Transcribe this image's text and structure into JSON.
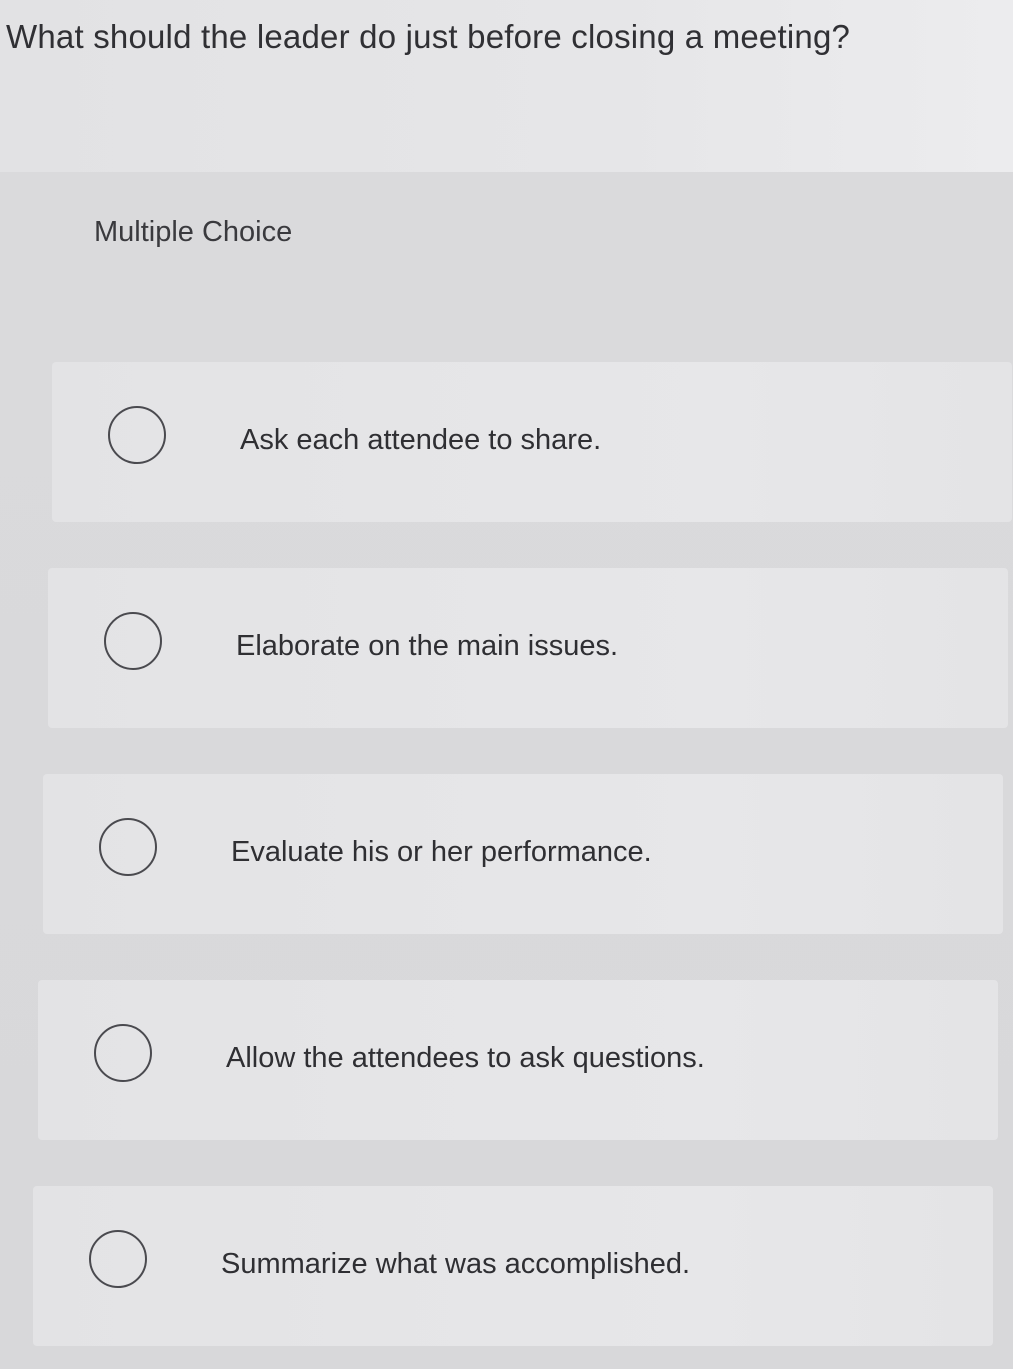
{
  "question": {
    "text": "What should the leader do just before closing a meeting?"
  },
  "question_type": "Multiple Choice",
  "options": [
    {
      "label": "Ask each attendee to share.",
      "selected": false
    },
    {
      "label": "Elaborate on the main issues.",
      "selected": false
    },
    {
      "label": "Evaluate his or her performance.",
      "selected": false
    },
    {
      "label": "Allow the attendees to ask questions.",
      "selected": false
    },
    {
      "label": "Summarize what was accomplished.",
      "selected": false
    }
  ],
  "colors": {
    "background": "#d9d9db",
    "option_background": "#e5e5e7",
    "text": "#2f2f33",
    "radio_border": "#4a4a4f"
  }
}
